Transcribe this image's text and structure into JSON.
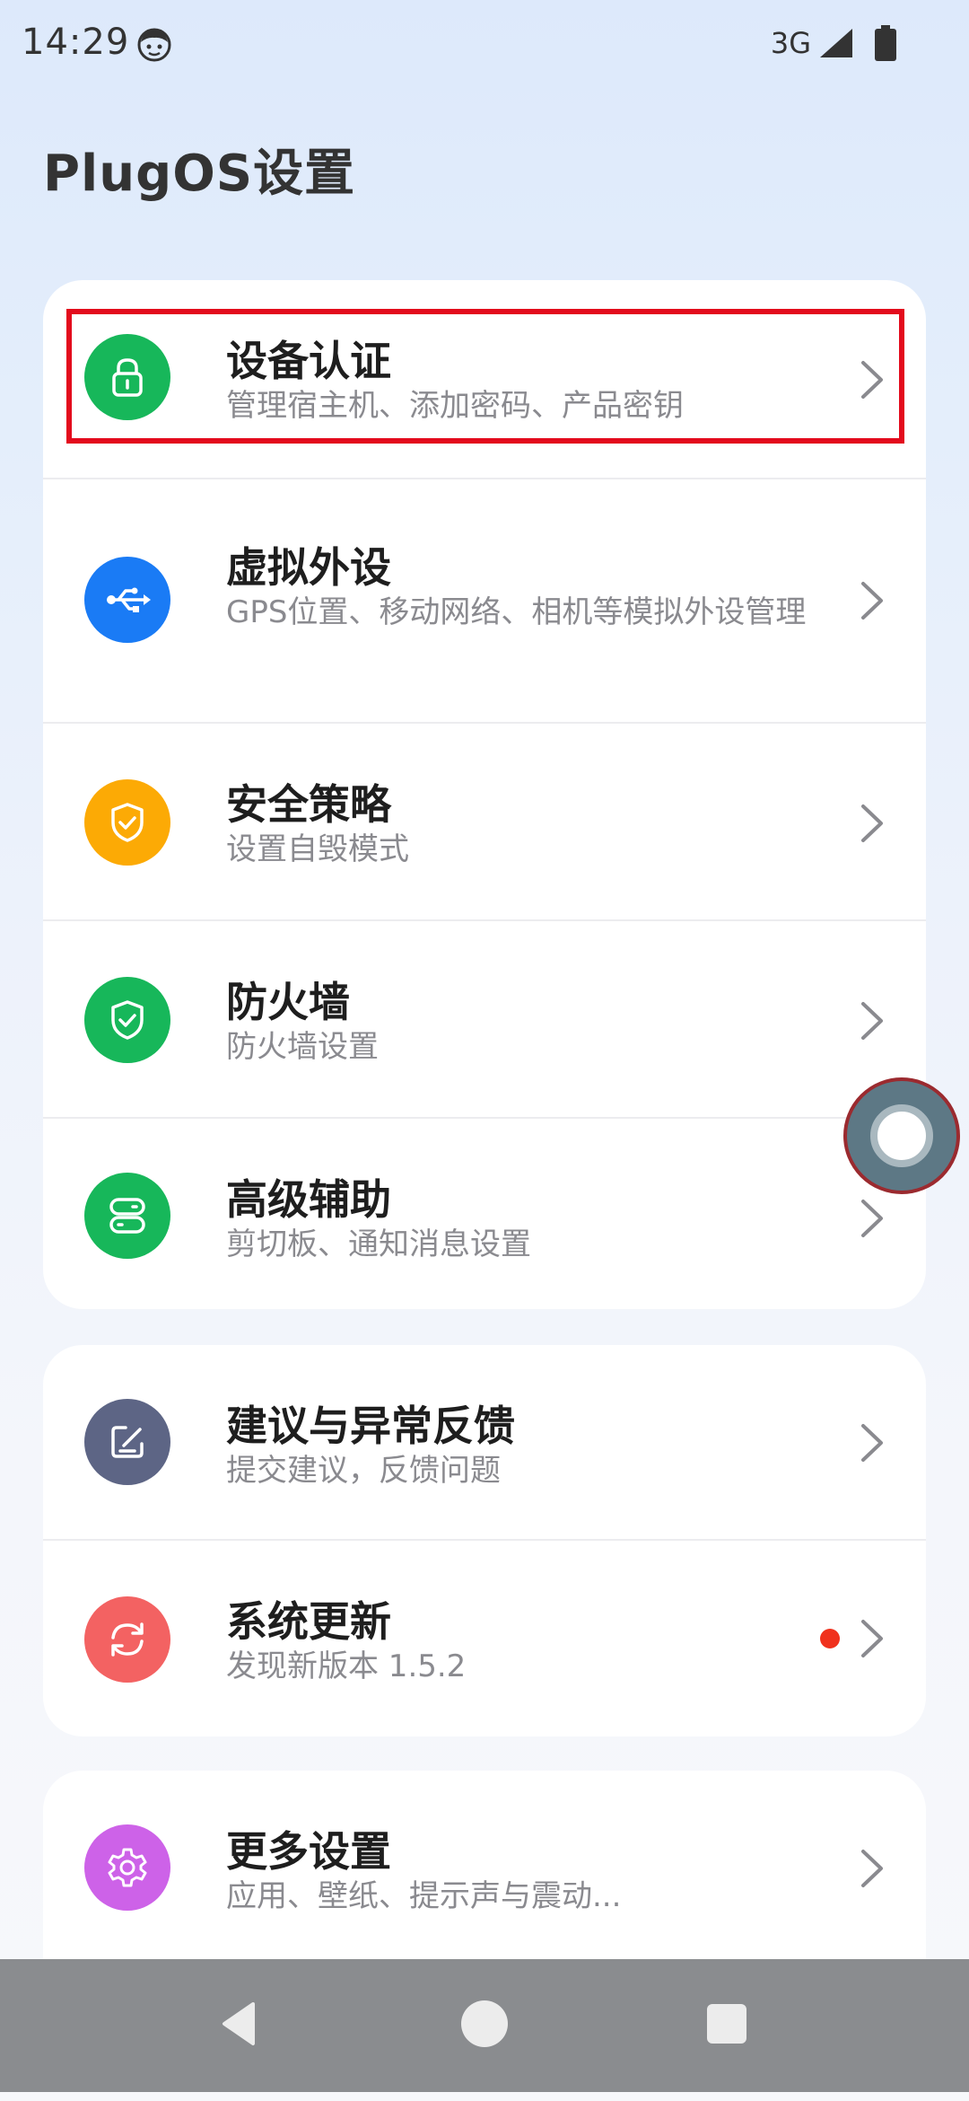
{
  "status_bar": {
    "time": "14:29",
    "network": "3G"
  },
  "page": {
    "title": "PlugOS设置"
  },
  "sections": [
    {
      "items": [
        {
          "title": "设备认证",
          "subtitle": "管理宿主机、添加密码、产品密钥",
          "icon": "lock-icon",
          "color": "#17b75a",
          "highlighted": true
        },
        {
          "title": "虚拟外设",
          "subtitle": "GPS位置、移动网络、相机等模拟外设管理",
          "icon": "usb-icon",
          "color": "#1a7bf5"
        },
        {
          "title": "安全策略",
          "subtitle": "设置自毁模式",
          "icon": "shield-check-icon",
          "color": "#fcaa05"
        },
        {
          "title": "防火墙",
          "subtitle": "防火墙设置",
          "icon": "shield-check-icon",
          "color": "#17b75a"
        },
        {
          "title": "高级辅助",
          "subtitle": "剪切板、通知消息设置",
          "icon": "toggle-switch-icon",
          "color": "#17b75a"
        }
      ]
    },
    {
      "items": [
        {
          "title": "建议与异常反馈",
          "subtitle": "提交建议，反馈问题",
          "icon": "edit-note-icon",
          "color": "#5d6585"
        },
        {
          "title": "系统更新",
          "subtitle": "发现新版本 1.5.2",
          "icon": "refresh-icon",
          "color": "#f36262",
          "badge": true
        }
      ]
    },
    {
      "items": [
        {
          "title": "更多设置",
          "subtitle": "应用、壁纸、提示声与震动...",
          "icon": "gear-icon",
          "color": "#cd62e8"
        }
      ]
    }
  ],
  "nav_bar": {
    "buttons": [
      "back",
      "home",
      "recent-apps"
    ]
  }
}
